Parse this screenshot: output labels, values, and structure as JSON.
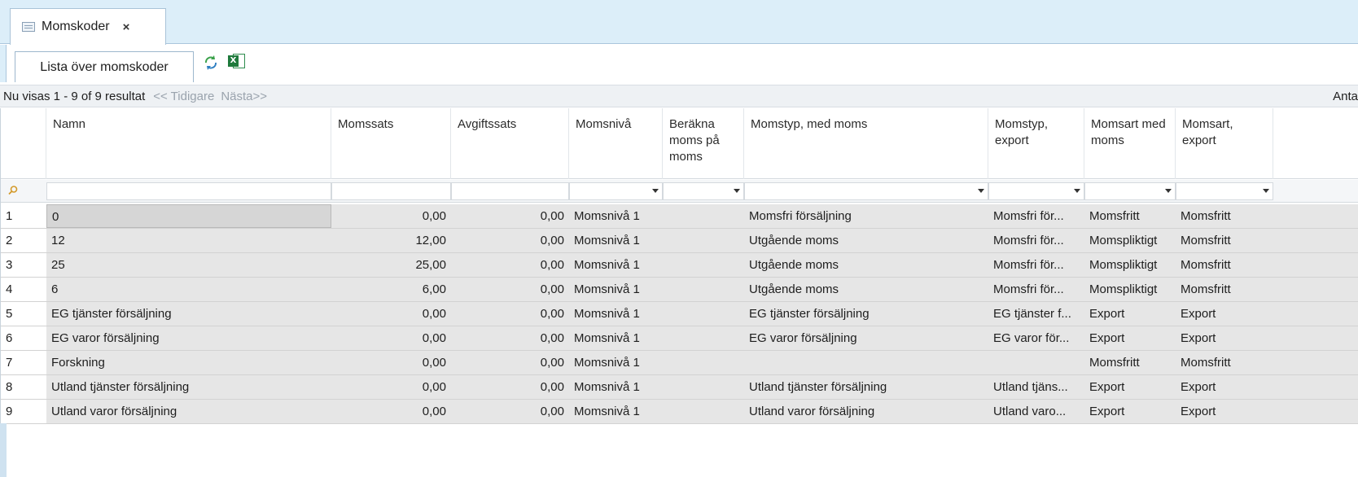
{
  "window": {
    "doc_tab_label": "Momskoder",
    "doc_tab_close": "×"
  },
  "toolbar": {
    "list_tab_label": "Lista över momskoder",
    "refresh_icon": "refresh-icon",
    "excel_icon": "excel-export-icon",
    "excel_glyph": "X"
  },
  "pager": {
    "status": "Nu visas 1 - 9 of 9 resultat",
    "prev": "<< Tidigare",
    "next": "Nästa>>",
    "right_text": "Anta"
  },
  "columns": [
    "Namn",
    "Momssats",
    "Avgiftssats",
    "Momsnivå",
    "Beräkna moms på moms",
    "Momstyp, med moms",
    "Momstyp, export",
    "Momsart med moms",
    "Momsart, export"
  ],
  "rows": [
    {
      "n": "1",
      "namn": "0",
      "momssats": "0,00",
      "avgiftssats": "0,00",
      "momsniva": "Momsnivå 1",
      "berakna": "",
      "momstyp": "Momsfri försäljning",
      "momstyp_export": "Momsfri för...",
      "momsart": "Momsfritt",
      "momsart_export": "Momsfritt"
    },
    {
      "n": "2",
      "namn": "12",
      "momssats": "12,00",
      "avgiftssats": "0,00",
      "momsniva": "Momsnivå 1",
      "berakna": "",
      "momstyp": "Utgående moms",
      "momstyp_export": "Momsfri för...",
      "momsart": "Momspliktigt",
      "momsart_export": "Momsfritt"
    },
    {
      "n": "3",
      "namn": "25",
      "momssats": "25,00",
      "avgiftssats": "0,00",
      "momsniva": "Momsnivå 1",
      "berakna": "",
      "momstyp": "Utgående moms",
      "momstyp_export": "Momsfri för...",
      "momsart": "Momspliktigt",
      "momsart_export": "Momsfritt"
    },
    {
      "n": "4",
      "namn": "6",
      "momssats": "6,00",
      "avgiftssats": "0,00",
      "momsniva": "Momsnivå 1",
      "berakna": "",
      "momstyp": "Utgående moms",
      "momstyp_export": "Momsfri för...",
      "momsart": "Momspliktigt",
      "momsart_export": "Momsfritt"
    },
    {
      "n": "5",
      "namn": "EG tjänster försäljning",
      "momssats": "0,00",
      "avgiftssats": "0,00",
      "momsniva": "Momsnivå 1",
      "berakna": "",
      "momstyp": "EG tjänster försäljning",
      "momstyp_export": "EG tjänster f...",
      "momsart": "Export",
      "momsart_export": "Export"
    },
    {
      "n": "6",
      "namn": "EG varor försäljning",
      "momssats": "0,00",
      "avgiftssats": "0,00",
      "momsniva": "Momsnivå 1",
      "berakna": "",
      "momstyp": "EG varor försäljning",
      "momstyp_export": "EG varor för...",
      "momsart": "Export",
      "momsart_export": "Export"
    },
    {
      "n": "7",
      "namn": "Forskning",
      "momssats": "0,00",
      "avgiftssats": "0,00",
      "momsniva": "Momsnivå 1",
      "berakna": "",
      "momstyp": "",
      "momstyp_export": "",
      "momsart": "Momsfritt",
      "momsart_export": "Momsfritt"
    },
    {
      "n": "8",
      "namn": "Utland tjänster försäljning",
      "momssats": "0,00",
      "avgiftssats": "0,00",
      "momsniva": "Momsnivå 1",
      "berakna": "",
      "momstyp": "Utland tjänster försäljning",
      "momstyp_export": "Utland tjäns...",
      "momsart": "Export",
      "momsart_export": "Export"
    },
    {
      "n": "9",
      "namn": "Utland varor försäljning",
      "momssats": "0,00",
      "avgiftssats": "0,00",
      "momsniva": "Momsnivå 1",
      "berakna": "",
      "momstyp": "Utland varor försäljning",
      "momstyp_export": "Utland varo...",
      "momsart": "Export",
      "momsart_export": "Export"
    }
  ],
  "colors": {
    "titlebar_bg": "#dceef9",
    "row_bg": "#e6e6e6",
    "excel_green": "#1f7a3c",
    "refresh_green": "#3aa14a"
  }
}
